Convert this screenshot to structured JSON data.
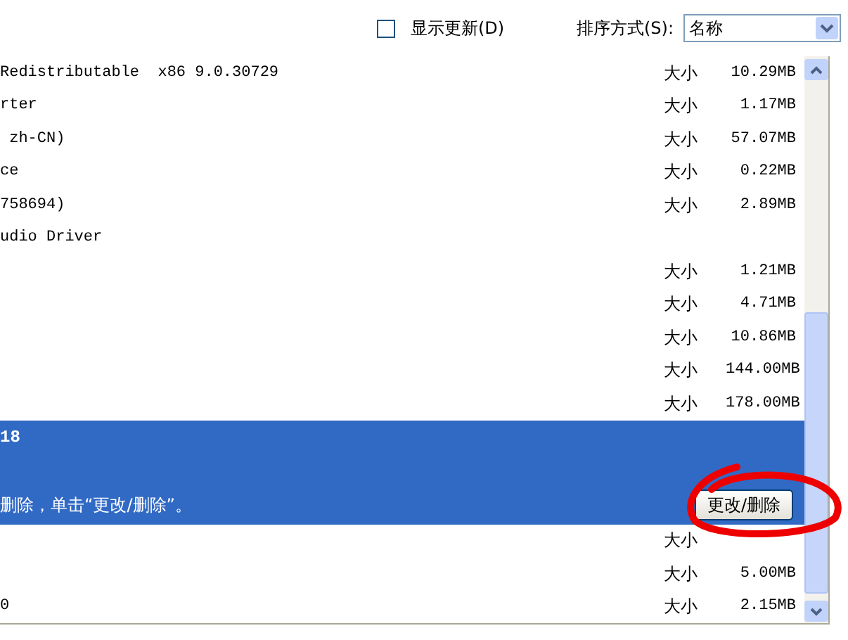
{
  "toolbar": {
    "show_updates": {
      "label": "显示更新(D)",
      "checked": false
    },
    "sort": {
      "label": "排序方式(S):",
      "value": "名称"
    }
  },
  "programs": [
    {
      "name": "Redistributable  x86 9.0.30729",
      "size_label": "大小",
      "size": "10.29MB",
      "selected": false
    },
    {
      "name": "rter",
      "size_label": "大小",
      "size": "1.17MB",
      "selected": false
    },
    {
      "name": " zh-CN)",
      "size_label": "大小",
      "size": "57.07MB",
      "selected": false
    },
    {
      "name": "ce",
      "size_label": "大小",
      "size": "0.22MB",
      "selected": false
    },
    {
      "name": "758694)",
      "size_label": "大小",
      "size": "2.89MB",
      "selected": false
    },
    {
      "name": "udio Driver",
      "selected": false
    },
    {
      "size_label": "大小",
      "size": "1.21MB",
      "selected": false
    },
    {
      "size_label": "大小",
      "size": "4.71MB",
      "selected": false
    },
    {
      "size_label": "大小",
      "size": "10.86MB",
      "selected": false
    },
    {
      "size_label": "大小",
      "size": "144.00MB",
      "selected": false
    },
    {
      "size_label": "大小",
      "size": "178.00MB",
      "selected": false
    },
    {
      "name": "18",
      "detail": "删除，单击“更改/删除”。",
      "button": "更改/删除",
      "selected": true
    },
    {
      "size_label": "大小",
      "selected": false
    },
    {
      "size_label": "大小",
      "size": "5.00MB",
      "selected": false
    },
    {
      "name": "0",
      "size_label": "大小",
      "size": "2.15MB",
      "selected": false
    }
  ]
}
